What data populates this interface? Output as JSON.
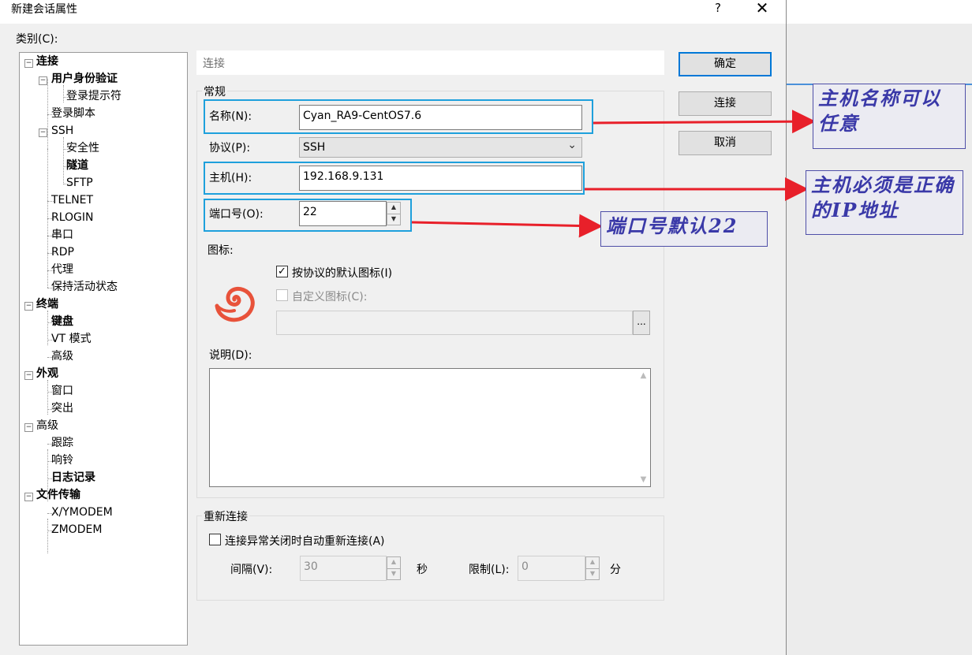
{
  "window": {
    "title": "新建会话属性",
    "help": "?",
    "close": "✕"
  },
  "category": {
    "label": "类别(C):",
    "items": [
      {
        "label": "连接"
      },
      {
        "label": "用户身份验证"
      },
      {
        "label": "登录提示符"
      },
      {
        "label": "登录脚本"
      },
      {
        "label": "SSH"
      },
      {
        "label": "安全性"
      },
      {
        "label": "隧道"
      },
      {
        "label": "SFTP"
      },
      {
        "label": "TELNET"
      },
      {
        "label": "RLOGIN"
      },
      {
        "label": "串口"
      },
      {
        "label": "RDP"
      },
      {
        "label": "代理"
      },
      {
        "label": "保持活动状态"
      },
      {
        "label": "终端"
      },
      {
        "label": "键盘"
      },
      {
        "label": "VT 模式"
      },
      {
        "label": "高级"
      },
      {
        "label": "外观"
      },
      {
        "label": "窗口"
      },
      {
        "label": "突出"
      },
      {
        "label": "高级"
      },
      {
        "label": "跟踪"
      },
      {
        "label": "响铃"
      },
      {
        "label": "日志记录"
      },
      {
        "label": "文件传输"
      },
      {
        "label": "X/YMODEM"
      },
      {
        "label": "ZMODEM"
      }
    ]
  },
  "panel": {
    "header": "连接",
    "general": {
      "title": "常规",
      "name_label": "名称(N):",
      "name_value": "Cyan_RA9-CentOS7.6",
      "protocol_label": "协议(P):",
      "protocol_value": "SSH",
      "host_label": "主机(H):",
      "host_value": "192.168.9.131",
      "port_label": "端口号(O):",
      "port_value": "22",
      "icon_label": "图标:",
      "default_icon_label": "按协议的默认图标(I)",
      "custom_icon_label": "自定义图标(C):",
      "browse_label": "...",
      "description_label": "说明(D):"
    },
    "reconnect": {
      "title": "重新连接",
      "auto_label": "连接异常关闭时自动重新连接(A)",
      "interval_label": "间隔(V):",
      "interval_value": "30",
      "interval_unit": "秒",
      "limit_label": "限制(L):",
      "limit_value": "0",
      "limit_unit": "分"
    }
  },
  "buttons": {
    "ok": "确定",
    "connect": "连接",
    "cancel": "取消"
  },
  "annotations": {
    "host_name_note": "主机名称可以任意",
    "host_note": "主机必须是正确的IP地址",
    "port_note": "端口号默认22",
    "highlight_color": "#1ea0dc",
    "arrow_color": "#e8202a"
  }
}
